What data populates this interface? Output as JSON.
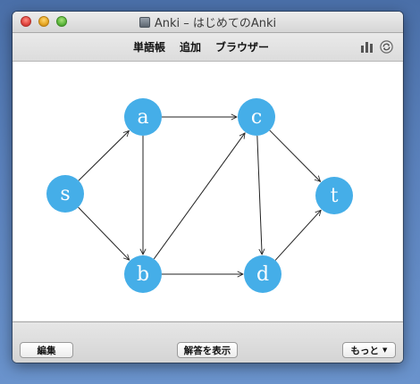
{
  "window": {
    "title": "Anki – はじめてのAnki",
    "app_icon": "anki-icon"
  },
  "toolbar": {
    "items": [
      {
        "label": "単語帳"
      },
      {
        "label": "追加"
      },
      {
        "label": "ブラウザー"
      }
    ],
    "right_icons": [
      "stats-icon",
      "sync-icon"
    ]
  },
  "graph": {
    "node_color": "#45aee8",
    "nodes": [
      {
        "id": "s",
        "label": "s"
      },
      {
        "id": "a",
        "label": "a"
      },
      {
        "id": "b",
        "label": "b"
      },
      {
        "id": "c",
        "label": "c"
      },
      {
        "id": "d",
        "label": "d"
      },
      {
        "id": "t",
        "label": "t"
      }
    ],
    "edges": [
      [
        "s",
        "a"
      ],
      [
        "s",
        "b"
      ],
      [
        "a",
        "b"
      ],
      [
        "a",
        "c"
      ],
      [
        "b",
        "c"
      ],
      [
        "b",
        "d"
      ],
      [
        "c",
        "d"
      ],
      [
        "c",
        "t"
      ],
      [
        "d",
        "t"
      ]
    ]
  },
  "bottombar": {
    "edit_label": "編集",
    "show_answer_label": "解答を表示",
    "more_label": "もっと",
    "more_icon": "chevron-down-icon"
  }
}
